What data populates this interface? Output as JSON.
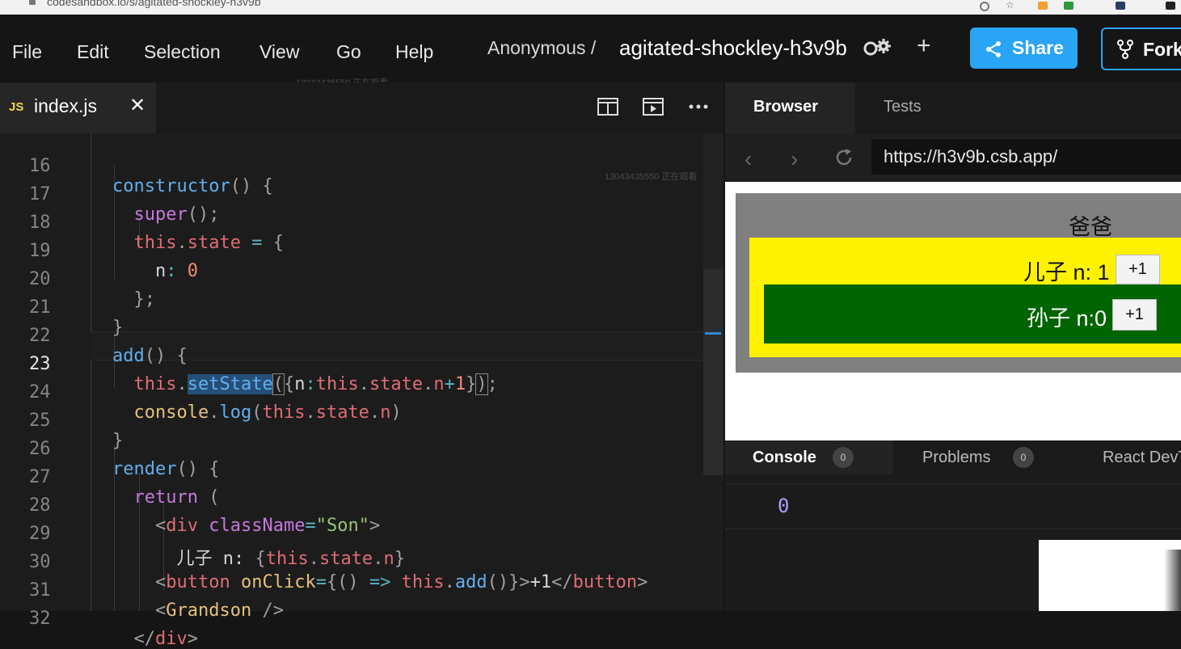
{
  "browser_chrome": {
    "url": "codesandbox.io/s/agitated-shockley-h3v9b"
  },
  "menu": {
    "items": [
      "File",
      "Edit",
      "Selection",
      "View",
      "Go",
      "Help"
    ]
  },
  "header": {
    "owner": "Anonymous /",
    "project_name": "agitated-shockley-h3v9b",
    "share_label": "Share",
    "fork_label": "Fork"
  },
  "watermark": {
    "text": "13043435550 正在观看"
  },
  "editor": {
    "tab": {
      "badge": "JS",
      "filename": "index.js",
      "close": "✕"
    },
    "active_line": "23",
    "line_numbers": [
      "16",
      "17",
      "18",
      "19",
      "20",
      "21",
      "22",
      "23",
      "24",
      "25",
      "26",
      "27",
      "28",
      "29",
      "30",
      "31",
      "32"
    ]
  },
  "browser": {
    "tabs": [
      "Browser",
      "Tests"
    ],
    "url": "https://h3v9b.csb.app/",
    "preview": {
      "dad_label": "爸爸",
      "son_label": "儿子 n: 1",
      "son_button": "+1",
      "grandson_label": "孙子 n:0",
      "grandson_button": "+1"
    }
  },
  "console": {
    "tabs": [
      {
        "label": "Console",
        "count": "0"
      },
      {
        "label": "Problems",
        "count": "0"
      },
      {
        "label": "React DevTools"
      }
    ],
    "output": "0"
  },
  "colors": {
    "accent": "#2aa4f4",
    "dad_bg": "#808080",
    "son_bg": "#fff200",
    "grandson_bg": "#006400"
  }
}
